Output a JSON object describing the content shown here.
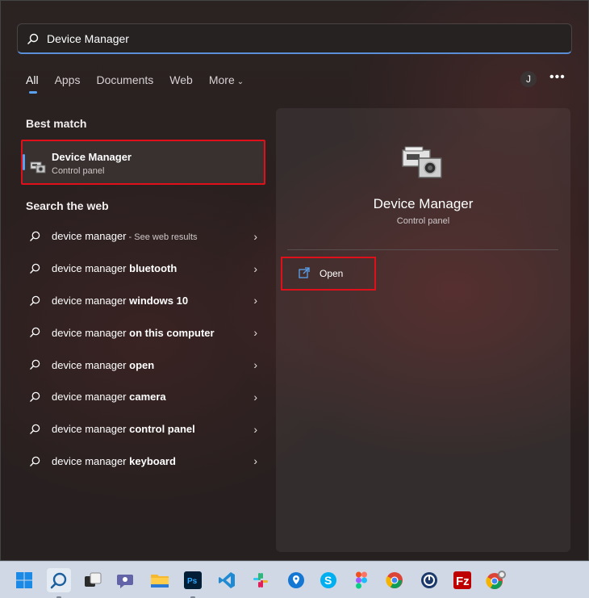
{
  "search": {
    "value": "Device Manager",
    "accent_color": "#5aa2f0"
  },
  "tabs": [
    {
      "label": "All"
    },
    {
      "label": "Apps"
    },
    {
      "label": "Documents"
    },
    {
      "label": "Web"
    },
    {
      "label": "More"
    }
  ],
  "header": {
    "avatar_initial": "J",
    "more_label": "•••"
  },
  "best_match": {
    "heading": "Best match",
    "name": "Device Manager",
    "subtitle": "Control panel",
    "icon": "device-manager-icon"
  },
  "web": {
    "heading": "Search the web",
    "items": [
      {
        "prefix": "device manager",
        "bold": "",
        "hint": " - See web results"
      },
      {
        "prefix": "device manager ",
        "bold": "bluetooth",
        "hint": ""
      },
      {
        "prefix": "device manager ",
        "bold": "windows 10",
        "hint": ""
      },
      {
        "prefix": "device manager ",
        "bold": "on this computer",
        "hint": ""
      },
      {
        "prefix": "device manager ",
        "bold": "open",
        "hint": ""
      },
      {
        "prefix": "device manager ",
        "bold": "camera",
        "hint": ""
      },
      {
        "prefix": "device manager ",
        "bold": "control panel",
        "hint": ""
      },
      {
        "prefix": "device manager ",
        "bold": "keyboard",
        "hint": ""
      }
    ]
  },
  "detail": {
    "title": "Device Manager",
    "subtitle": "Control panel",
    "open_label": "Open"
  },
  "highlight_color": "#e0101a",
  "taskbar": {
    "apps": [
      "windows-start-icon",
      "search-icon",
      "task-view-icon",
      "teams-chat-icon",
      "file-explorer-icon",
      "photoshop-icon",
      "vscode-icon",
      "slack-icon",
      "maps-pin-icon",
      "skype-icon",
      "figma-icon",
      "chrome-icon",
      "clock-app-icon",
      "filezilla-icon",
      "chrome-profile-icon"
    ],
    "photoshop_label": "Ps"
  }
}
